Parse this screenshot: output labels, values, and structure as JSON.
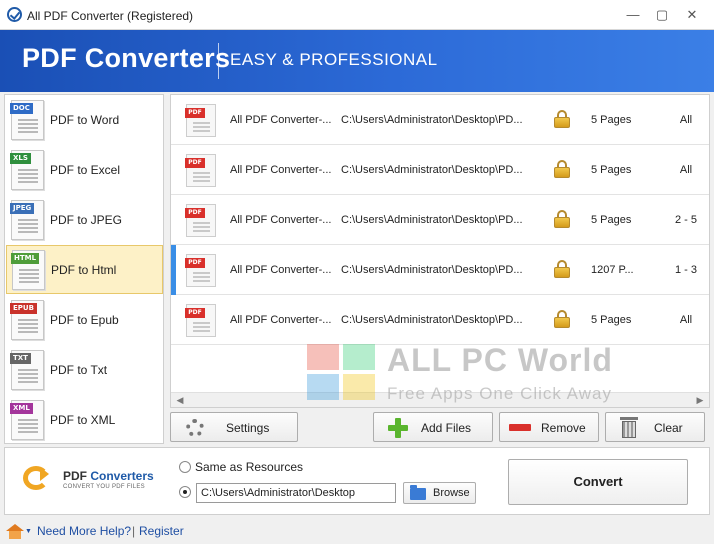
{
  "window": {
    "title": "All PDF Converter (Registered)",
    "minimize": "—",
    "maximize": "▢",
    "close": "✕"
  },
  "banner": {
    "brand": "PDF Converters",
    "tagline": "EASY & PROFESSIONAL"
  },
  "sidebar": {
    "items": [
      {
        "tag": "DOC",
        "label": "PDF to Word",
        "color": "#2e6bc6",
        "active": false
      },
      {
        "tag": "XLS",
        "label": "PDF to Excel",
        "color": "#2f8f3d",
        "active": false
      },
      {
        "tag": "JPEG",
        "label": "PDF to JPEG",
        "color": "#3a6fb7",
        "active": false
      },
      {
        "tag": "HTML",
        "label": "PDF to Html",
        "color": "#4f9d3a",
        "active": true
      },
      {
        "tag": "EPUB",
        "label": "PDF to Epub",
        "color": "#c9322b",
        "active": false
      },
      {
        "tag": "TXT",
        "label": "PDF to Txt",
        "color": "#666666",
        "active": false
      },
      {
        "tag": "XML",
        "label": "PDF to XML",
        "color": "#a3359b",
        "active": false
      }
    ]
  },
  "files": {
    "icon_tag": "PDF",
    "rows": [
      {
        "name": "All PDF Converter-...",
        "path": "C:\\Users\\Administrator\\Desktop\\PD...",
        "pages": "5 Pages",
        "range": "All",
        "selected": false
      },
      {
        "name": "All PDF Converter-...",
        "path": "C:\\Users\\Administrator\\Desktop\\PD...",
        "pages": "5 Pages",
        "range": "All",
        "selected": false
      },
      {
        "name": "All PDF Converter-...",
        "path": "C:\\Users\\Administrator\\Desktop\\PD...",
        "pages": "5 Pages",
        "range": "2 - 5",
        "selected": false
      },
      {
        "name": "All PDF Converter-...",
        "path": "C:\\Users\\Administrator\\Desktop\\PD...",
        "pages": "1207 P...",
        "range": "1 - 3",
        "selected": true
      },
      {
        "name": "All PDF Converter-...",
        "path": "C:\\Users\\Administrator\\Desktop\\PD...",
        "pages": "5 Pages",
        "range": "All",
        "selected": false
      }
    ]
  },
  "watermark": {
    "title": "ALL PC World",
    "subtitle": "Free Apps One Click Away"
  },
  "toolbar": {
    "settings": "Settings",
    "add_files": "Add Files",
    "remove": "Remove",
    "clear": "Clear"
  },
  "output": {
    "logo_pdf": "PDF",
    "logo_word": "Converters",
    "logo_sub": "CONVERT YOU PDF FILES",
    "same_as_resources": "Same as Resources",
    "path_value": "C:\\Users\\Administrator\\Desktop",
    "browse": "Browse",
    "convert": "Convert",
    "selected_option": "custom-path"
  },
  "status": {
    "help": "Need More Help?",
    "separator": "|",
    "register": "Register"
  }
}
